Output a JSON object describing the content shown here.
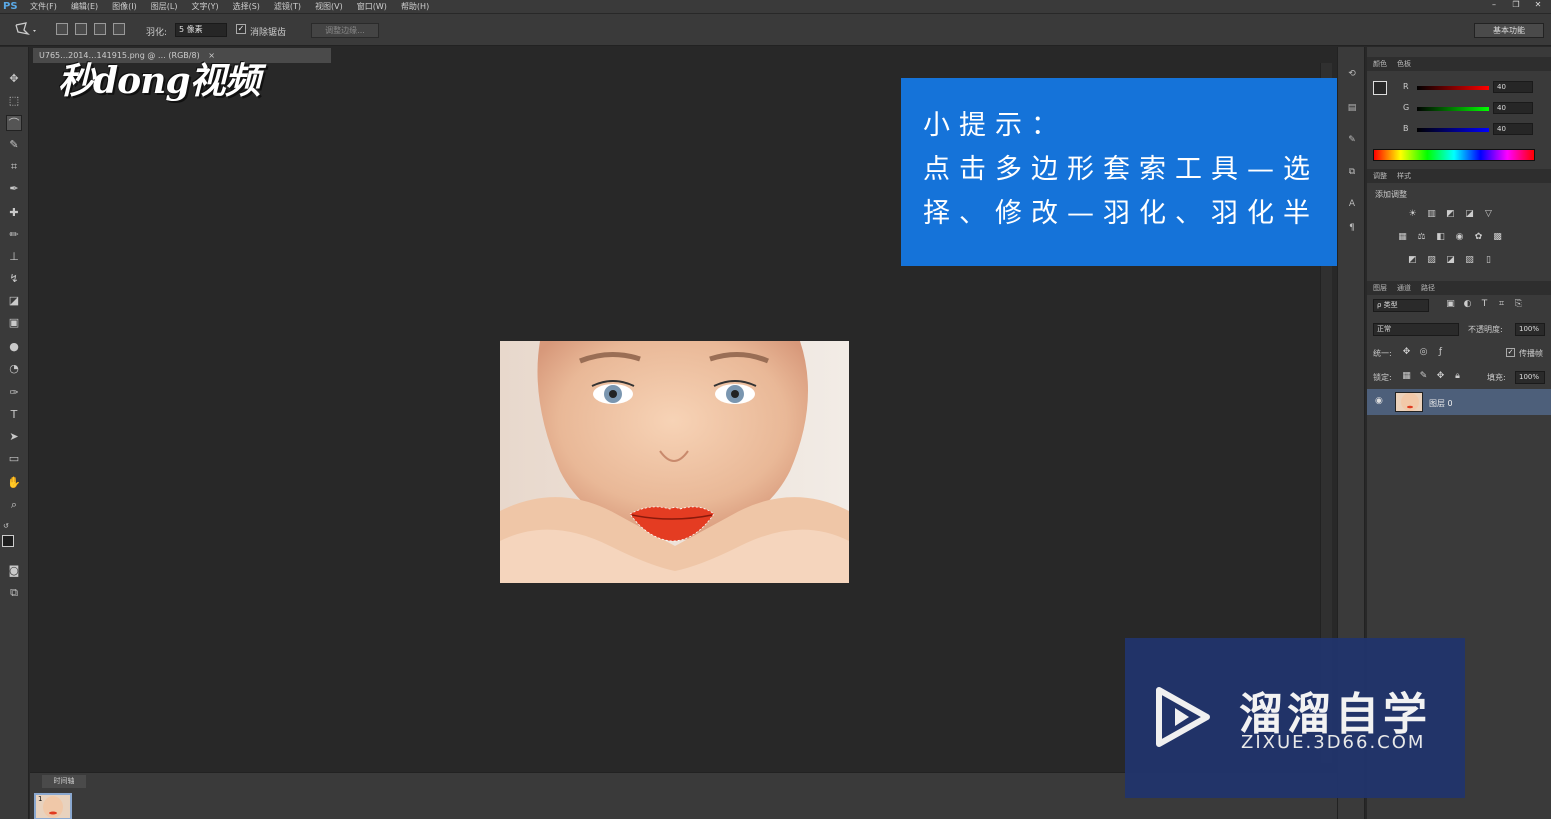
{
  "app": {
    "logo": "PS"
  },
  "menu": [
    "文件(F)",
    "编辑(E)",
    "图像(I)",
    "图层(L)",
    "文字(Y)",
    "选择(S)",
    "滤镜(T)",
    "视图(V)",
    "窗口(W)",
    "帮助(H)"
  ],
  "window_controls": {
    "minimize": "–",
    "restore": "❐",
    "close": "✕"
  },
  "options": {
    "feather_label": "羽化:",
    "feather_value": "5 像素",
    "antialias_label": "消除锯齿",
    "antialias_checked": "✓",
    "refine_edge": "调整边缘...",
    "workspace": "基本功能"
  },
  "document": {
    "tab_title": "U765…2014…141915.png @ … (RGB/8)",
    "tab_close": "×"
  },
  "watermark_logo": "秒dong视频",
  "tip": {
    "line1": "小提示：",
    "line2": "点击多边形套索工具—选",
    "line3": "择、修改—羽化、羽化半"
  },
  "color_panel": {
    "tabs": [
      "颜色",
      "色板"
    ],
    "channels": [
      {
        "label": "R",
        "value": "40",
        "color": "#ff3333"
      },
      {
        "label": "G",
        "value": "40",
        "color": "#33dd33"
      },
      {
        "label": "B",
        "value": "40",
        "color": "#3355ff"
      }
    ]
  },
  "adjust_panel": {
    "tabs": [
      "调整",
      "样式"
    ],
    "add_label": "添加调整"
  },
  "layers_panel": {
    "tabs": [
      "图层",
      "通道",
      "路径"
    ],
    "filter_kind": "ρ 类型",
    "blend_mode": "正常",
    "opacity_label": "不透明度:",
    "opacity_value": "100%",
    "unify_label": "统一:",
    "propagate_label": "传播帧",
    "lock_label": "锁定:",
    "fill_label": "填充:",
    "fill_value": "100%",
    "layer_name": "图层 0"
  },
  "timeline": {
    "tab": "时间轴",
    "frame_number": "1"
  },
  "site_watermark": {
    "title": "溜溜自学",
    "url": "ZIXUE.3D66.COM"
  }
}
